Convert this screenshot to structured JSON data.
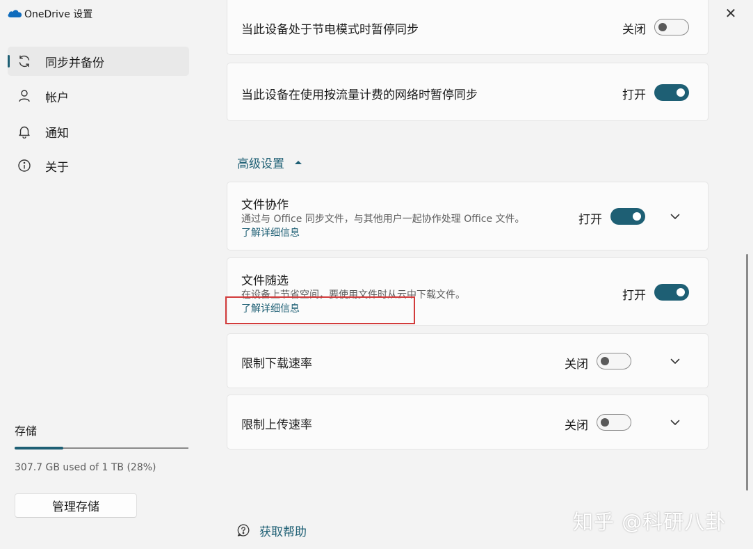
{
  "window": {
    "title": "OneDrive 设置",
    "controls": {
      "minimize": "—",
      "maximize": "☐",
      "close": "✕"
    }
  },
  "sidebar": {
    "items": [
      {
        "label": "同步并备份",
        "icon": "sync-icon",
        "active": true
      },
      {
        "label": "帐户",
        "icon": "person-icon",
        "active": false
      },
      {
        "label": "通知",
        "icon": "bell-icon",
        "active": false
      },
      {
        "label": "关于",
        "icon": "info-icon",
        "active": false
      }
    ],
    "storage": {
      "title": "存储",
      "used_text": "307.7 GB used of 1 TB (28%)",
      "percent": 28,
      "manage_button": "管理存储"
    }
  },
  "main": {
    "top_cards": [
      {
        "title": "当此设备处于节电模式时暂停同步",
        "state": "关闭",
        "on": false
      },
      {
        "title": "当此设备在使用按流量计费的网络时暂停同步",
        "state": "打开",
        "on": true
      }
    ],
    "advanced": {
      "header": "高级设置",
      "cards": [
        {
          "title": "文件协作",
          "desc": "通过与 Office 同步文件，与其他用户一起协作处理 Office 文件。",
          "link": "了解详细信息",
          "state": "打开",
          "on": true,
          "expandable": true
        },
        {
          "title": "文件随选",
          "desc": "在设备上节省空间，要使用文件时从云中下载文件。",
          "link": "了解详细信息",
          "state": "打开",
          "on": true,
          "expandable": false
        },
        {
          "title": "限制下载速率",
          "state": "关闭",
          "on": false,
          "expandable": true
        },
        {
          "title": "限制上传速率",
          "state": "关闭",
          "on": false,
          "expandable": true
        }
      ]
    },
    "help": {
      "label": "获取帮助",
      "icon": "help-icon"
    }
  },
  "watermark": "知乎 @科研八卦",
  "colors": {
    "accent": "#1e5f74",
    "highlight": "#d23b3b",
    "background": "#f3f3f3",
    "card": "#fbfbfb"
  }
}
